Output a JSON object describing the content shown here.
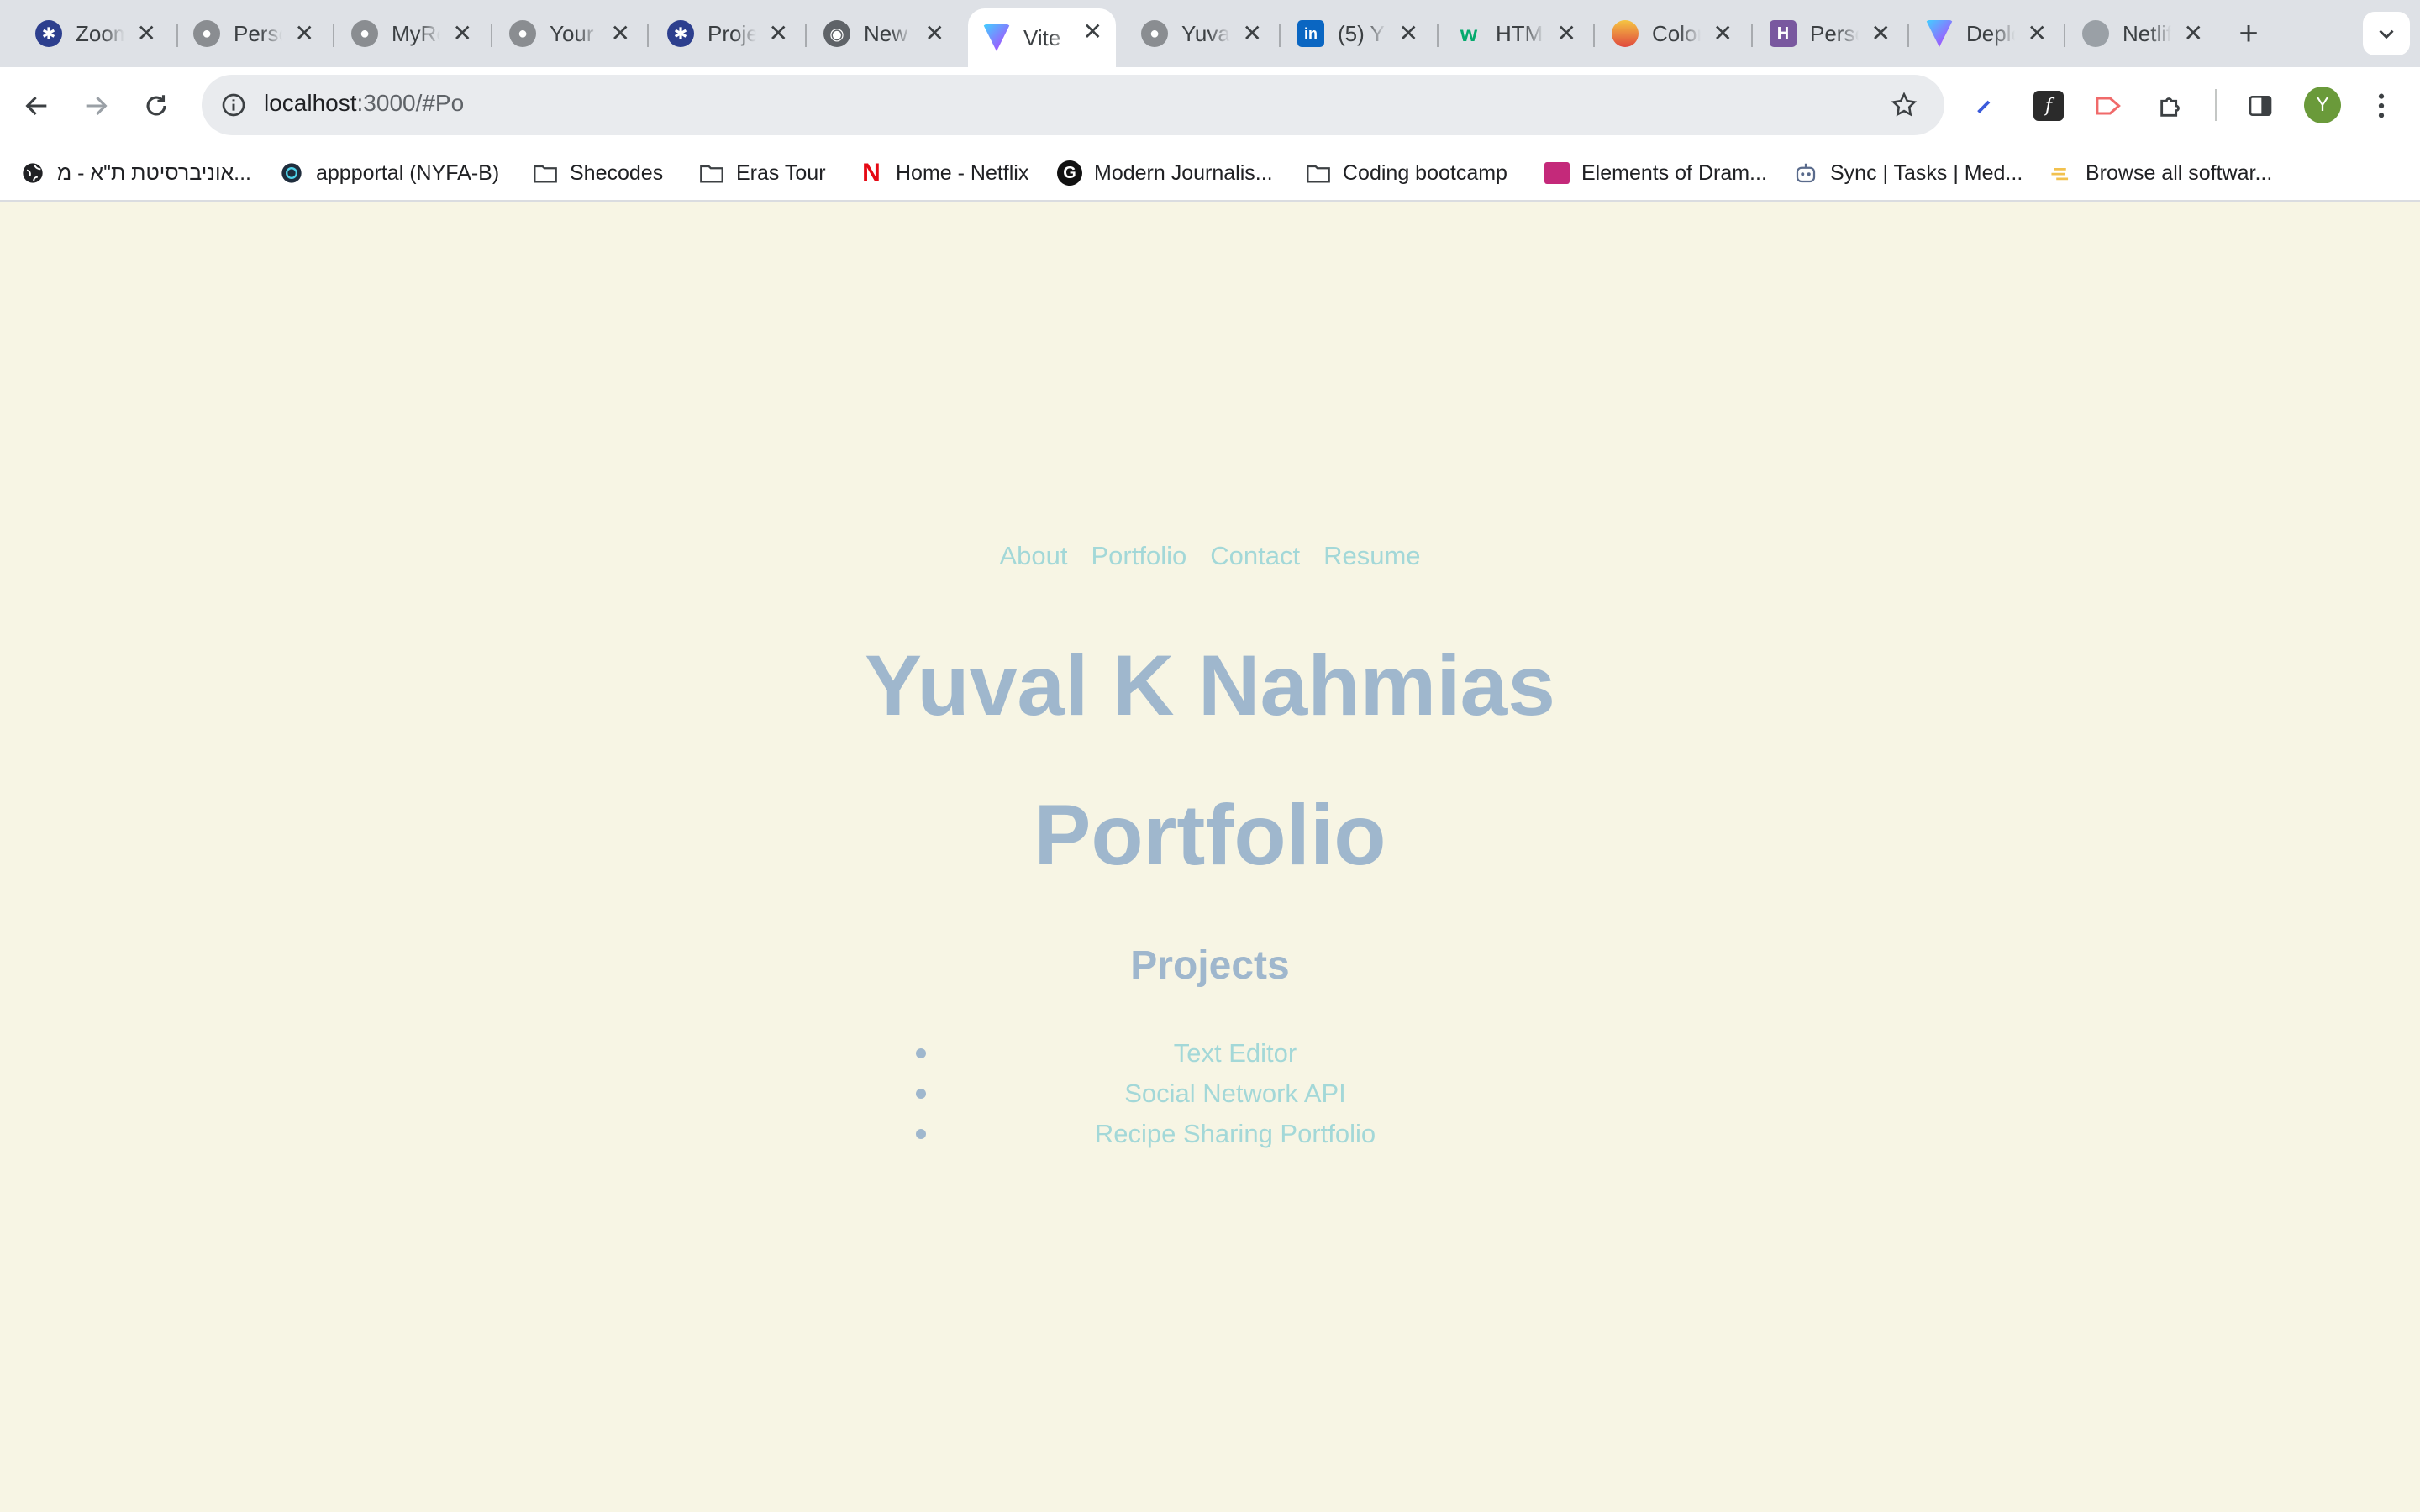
{
  "browser": {
    "tabs": [
      {
        "title": "Zoom",
        "favicon": "zoom-icon",
        "active": false
      },
      {
        "title": "Personal",
        "favicon": "github-icon",
        "active": false
      },
      {
        "title": "MyRepos",
        "favicon": "github-icon",
        "active": false
      },
      {
        "title": "Your",
        "favicon": "github-icon",
        "active": false
      },
      {
        "title": "Project",
        "favicon": "zoom-icon",
        "active": false
      },
      {
        "title": "New Tab",
        "favicon": "chrome-icon",
        "active": false
      },
      {
        "title": "Vite",
        "favicon": "vite-icon",
        "active": true
      },
      {
        "title": "Yuval",
        "favicon": "github-icon",
        "active": false
      },
      {
        "title": "(5) Y",
        "favicon": "linkedin-icon",
        "active": false
      },
      {
        "title": "HTML",
        "favicon": "w3schools-icon",
        "active": false
      },
      {
        "title": "Color",
        "favicon": "colorpicker-icon",
        "active": false
      },
      {
        "title": "Personal",
        "favicon": "heroku-icon",
        "active": false
      },
      {
        "title": "Deploy",
        "favicon": "vite-icon",
        "active": false
      },
      {
        "title": "Netlify",
        "favicon": "globe-icon",
        "active": false
      }
    ],
    "address": {
      "host": "localhost",
      "rest": ":3000/#Po"
    },
    "profile_initial": "Y",
    "bookmarks": [
      {
        "label": "אוניברסיטת ת\"א - מ...",
        "icon": "globe-icon"
      },
      {
        "label": "appportal (NYFA-B)",
        "icon": "appportal-icon"
      },
      {
        "label": "Shecodes",
        "icon": "folder-icon"
      },
      {
        "label": "Eras Tour",
        "icon": "folder-icon"
      },
      {
        "label": "Home - Netflix",
        "icon": "netflix-icon"
      },
      {
        "label": "Modern Journalis...",
        "icon": "g-icon"
      },
      {
        "label": "Coding bootcamp",
        "icon": "folder-icon"
      },
      {
        "label": "Elements of Dram...",
        "icon": "classroom-icon"
      },
      {
        "label": "Sync | Tasks | Med...",
        "icon": "sync-icon"
      },
      {
        "label": "Browse all softwar...",
        "icon": "software-icon"
      }
    ]
  },
  "page": {
    "nav": [
      "About",
      "Portfolio",
      "Contact",
      "Resume"
    ],
    "name": "Yuval K Nahmias",
    "section_title": "Portfolio",
    "subtitle": "Projects",
    "projects": [
      "Text Editor",
      "Social Network API",
      "Recipe Sharing Portfolio"
    ]
  },
  "colors": {
    "page_bg": "#f7f5e4",
    "heading": "#9fb7cd",
    "link": "#a3d8d8"
  }
}
